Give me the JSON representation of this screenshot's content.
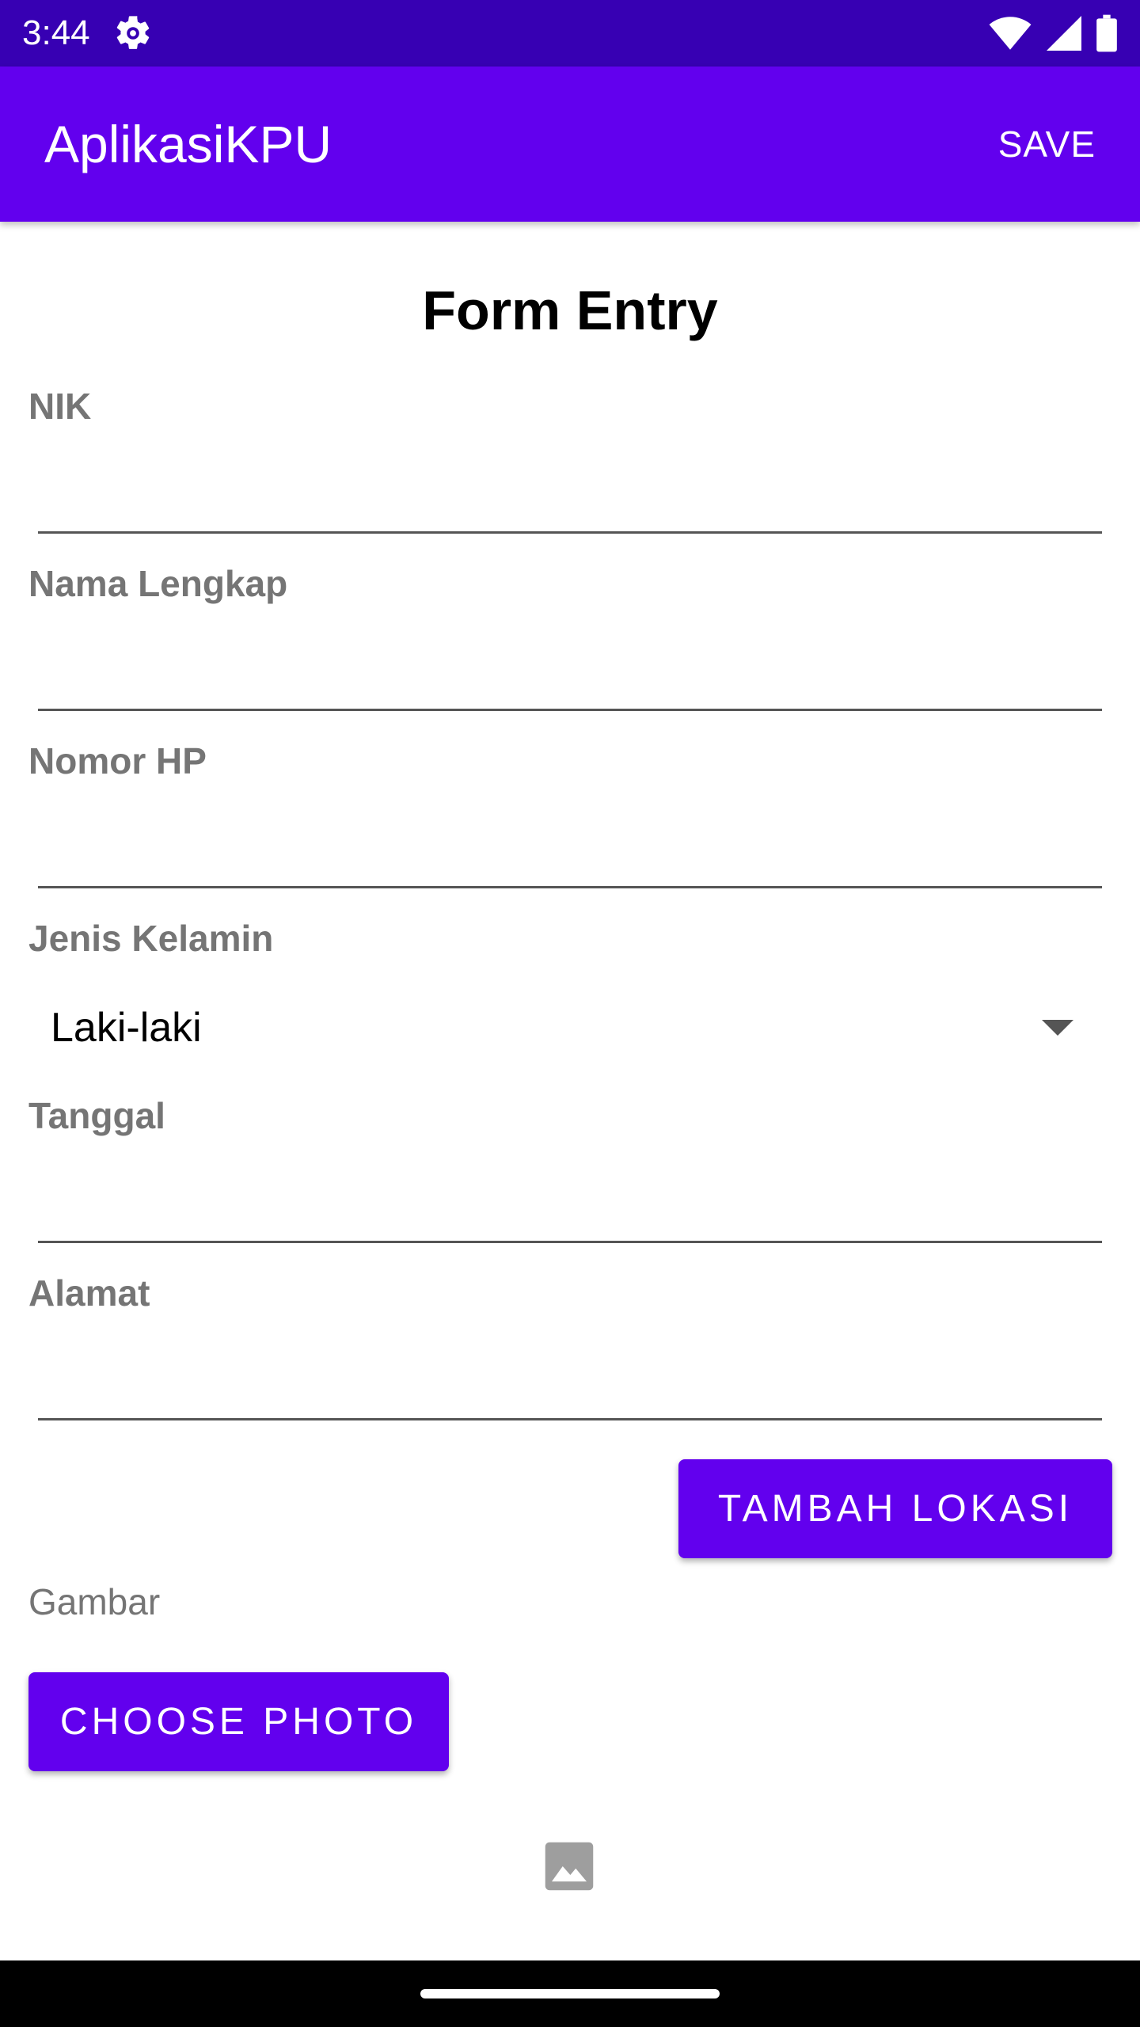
{
  "status_bar": {
    "time": "3:44",
    "icons": [
      "gear-icon",
      "wifi-icon",
      "cell-signal-icon",
      "battery-icon"
    ],
    "background": "#3700B3"
  },
  "app_bar": {
    "title": "AplikasiKPU",
    "action_label": "SAVE",
    "background": "#6200EE"
  },
  "form": {
    "heading": "Form Entry",
    "fields": {
      "nik": {
        "label": "NIK",
        "value": ""
      },
      "nama_lengkap": {
        "label": "Nama Lengkap",
        "value": ""
      },
      "nomor_hp": {
        "label": "Nomor HP",
        "value": ""
      },
      "jenis_kelamin": {
        "label": "Jenis Kelamin",
        "selected": "Laki-laki"
      },
      "tanggal": {
        "label": "Tanggal",
        "value": ""
      },
      "alamat": {
        "label": "Alamat",
        "value": ""
      }
    },
    "tambah_lokasi_label": "TAMBAH LOKASI",
    "gambar_label": "Gambar",
    "choose_photo_label": "CHOOSE PHOTO",
    "image_icon": "image-icon"
  },
  "accent_color": "#6200EE"
}
